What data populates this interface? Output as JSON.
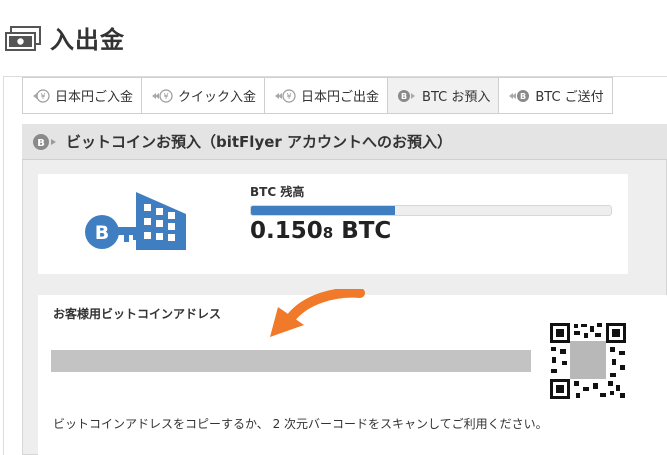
{
  "page": {
    "title": "入出金"
  },
  "tabs": [
    {
      "label": "日本円ご入金",
      "icon": "yen-deposit-icon"
    },
    {
      "label": "クイック入金",
      "icon": "yen-quick-icon"
    },
    {
      "label": "日本円ご出金",
      "icon": "yen-withdraw-icon"
    },
    {
      "label": "BTC お預入",
      "icon": "btc-deposit-icon",
      "active": true
    },
    {
      "label": "BTC ご送付",
      "icon": "btc-send-icon"
    }
  ],
  "panel": {
    "title": "ビットコインお預入（bitFlyer アカウントへのお預入）"
  },
  "balance": {
    "label": "BTC 残高",
    "value_main": "0.150",
    "value_small": "8",
    "unit": " BTC",
    "bar_fill_fraction": 0.4
  },
  "address": {
    "label": "お客様用ビットコインアドレス",
    "instructions": "ビットコインアドレスをコピーするか、 2 次元バーコードをスキャンしてご利用ください。"
  },
  "colors": {
    "accent_blue": "#3f7fc1",
    "arrow_orange": "#f07a2a",
    "panel_gray": "#eeeeee"
  }
}
